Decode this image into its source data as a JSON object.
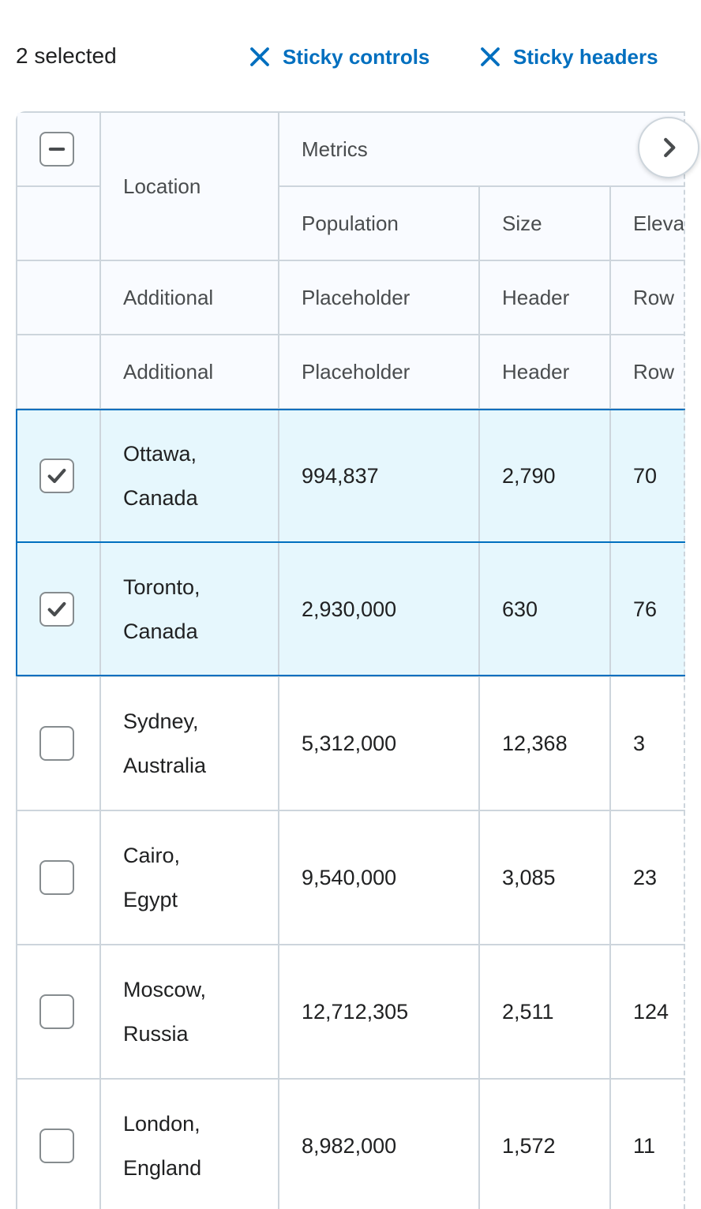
{
  "controls": {
    "selected_text": "2 selected",
    "sticky_controls_label": "Sticky controls",
    "sticky_headers_label": "Sticky headers"
  },
  "header": {
    "group_label": "Metrics",
    "location_label": "Location",
    "columns": [
      "Population",
      "Size",
      "Eleva"
    ],
    "extra_rows": [
      [
        "Additional",
        "Placeholder",
        "Header",
        "Row"
      ],
      [
        "Additional",
        "Placeholder",
        "Header",
        "Row"
      ]
    ]
  },
  "rows": [
    {
      "location_1": "Ottawa,",
      "location_2": "Canada",
      "population": "994,837",
      "size": "2,790",
      "elevation": "70",
      "selected": true
    },
    {
      "location_1": "Toronto,",
      "location_2": "Canada",
      "population": "2,930,000",
      "size": "630",
      "elevation": "76",
      "selected": true
    },
    {
      "location_1": "Sydney,",
      "location_2": "Australia",
      "population": "5,312,000",
      "size": "12,368",
      "elevation": "3",
      "selected": false
    },
    {
      "location_1": "Cairo,",
      "location_2": "Egypt",
      "population": "9,540,000",
      "size": "3,085",
      "elevation": "23",
      "selected": false
    },
    {
      "location_1": "Moscow,",
      "location_2": "Russia",
      "population": "12,712,305",
      "size": "2,511",
      "elevation": "124",
      "selected": false
    },
    {
      "location_1": "London,",
      "location_2": "England",
      "population": "8,982,000",
      "size": "1,572",
      "elevation": "11",
      "selected": false
    }
  ],
  "colors": {
    "accent": "#006fbf",
    "selected_row_bg": "#e6f7fd",
    "header_bg": "#f9fbff",
    "border": "#cdd5dc"
  },
  "icons": {
    "sticky_controls": "close-icon",
    "sticky_headers": "close-icon",
    "select_all": "minus-icon",
    "row_check": "checkmark-icon",
    "scroll": "chevron-right-icon"
  }
}
